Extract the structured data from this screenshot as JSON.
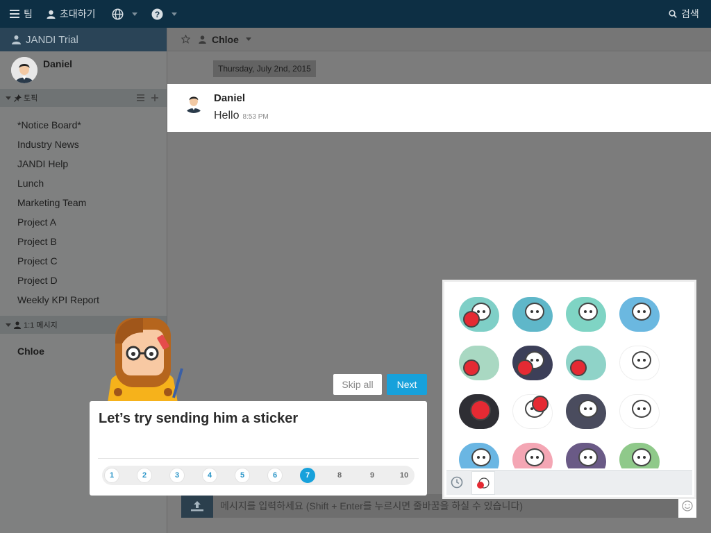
{
  "topbar": {
    "team_label": "팀",
    "invite_label": "초대하기",
    "search_label": "검색"
  },
  "sidebar": {
    "team_name": "JANDI Trial",
    "profile_name": "Daniel",
    "topics_header": "토픽",
    "topics": [
      "*Notice Board*",
      "Industry News",
      "JANDI Help",
      "Lunch",
      "Marketing Team",
      "Project A",
      "Project B",
      "Project C",
      "Project D",
      "Weekly KPI Report"
    ],
    "dm_header": "1:1 메시지",
    "dm_items": [
      "Chloe"
    ]
  },
  "channel": {
    "name": "Chloe",
    "date_divider": "Thursday, July 2nd, 2015",
    "message": {
      "author": "Daniel",
      "text": "Hello",
      "time": "8:53 PM"
    },
    "input_placeholder": "메시지를 입력하세요 (Shift + Enter를 누르시면 줄바꿈을 하실 수 있습니다)"
  },
  "tutorial": {
    "title": "Let’s try sending him a sticker",
    "skip_label": "Skip all",
    "next_label": "Next",
    "steps": [
      "1",
      "2",
      "3",
      "4",
      "5",
      "6",
      "7",
      "8",
      "9",
      "10"
    ],
    "current_step": 7
  },
  "stickers": {
    "colors": [
      "#7fcfc7",
      "#5fb7c9",
      "#7fd4c4",
      "#6bb8e0",
      "#a9d8c2",
      "#3c3f58",
      "#8fd3c8",
      "#ffffff",
      "#2e2e34",
      "#ffffff",
      "#4a4c5e",
      "#ffffff",
      "#6ab6e3",
      "#f4a6b4",
      "#6a5a86",
      "#8fc98a"
    ]
  },
  "colors": {
    "accent": "#17a1db",
    "topbar": "#0d2f44"
  }
}
